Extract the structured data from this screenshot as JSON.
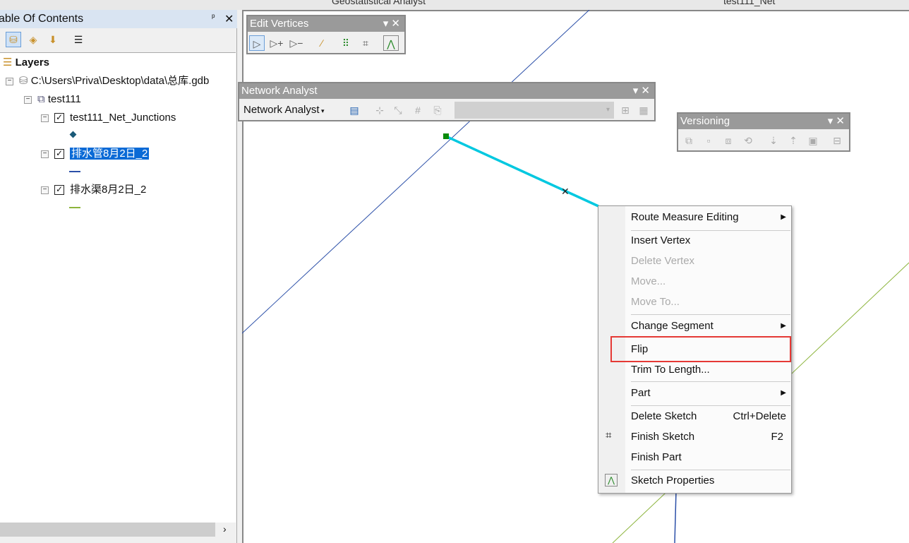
{
  "top_toolbar": {
    "geostat_label": "Geostatistical Analyst",
    "network_select": "test111_Net"
  },
  "toc": {
    "title": "Table Of Contents",
    "pin": "📌",
    "close": "✕",
    "tree": {
      "root": "Layers",
      "gdb": "C:\\Users\\Priva\\Desktop\\data\\总库.gdb",
      "dataset": "test111",
      "layers": [
        {
          "name": "test111_Net_Junctions",
          "checked": true,
          "symbol": "point",
          "color": "#1a5a78"
        },
        {
          "name": "排水管8月2日_2",
          "checked": true,
          "selected": true,
          "symbol": "line",
          "color": "#2b4fa8"
        },
        {
          "name": "排水渠8月2日_2",
          "checked": true,
          "symbol": "line",
          "color": "#8cb43c"
        }
      ]
    }
  },
  "toolbars": {
    "edit_vertices": {
      "title": "Edit Vertices"
    },
    "network_analyst": {
      "title": "Network Analyst",
      "menu_label": "Network Analyst"
    },
    "versioning": {
      "title": "Versioning"
    }
  },
  "context_menu": {
    "items": [
      {
        "label": "Route Measure Editing",
        "submenu": true,
        "enabled": true
      },
      {
        "label": "Insert Vertex",
        "enabled": true
      },
      {
        "label": "Delete Vertex",
        "enabled": false
      },
      {
        "label": "Move...",
        "enabled": false
      },
      {
        "label": "Move To...",
        "enabled": false
      },
      {
        "label": "Change Segment",
        "submenu": true,
        "enabled": true
      },
      {
        "label": "Flip",
        "enabled": true,
        "highlighted": true
      },
      {
        "label": "Trim To Length...",
        "enabled": true
      },
      {
        "label": "Part",
        "submenu": true,
        "enabled": true
      },
      {
        "label": "Delete Sketch",
        "shortcut": "Ctrl+Delete",
        "enabled": true
      },
      {
        "label": "Finish Sketch",
        "shortcut": "F2",
        "icon": "finish-sketch-icon",
        "enabled": true
      },
      {
        "label": "Finish Part",
        "enabled": true
      },
      {
        "label": "Sketch Properties",
        "icon": "sketch-properties-icon",
        "enabled": true
      }
    ]
  },
  "colors": {
    "highlight_box": "#e53935",
    "selected_segment": "#00c8e0",
    "pipe_line": "#2b4fa8",
    "channel_line": "#8cb43c"
  }
}
